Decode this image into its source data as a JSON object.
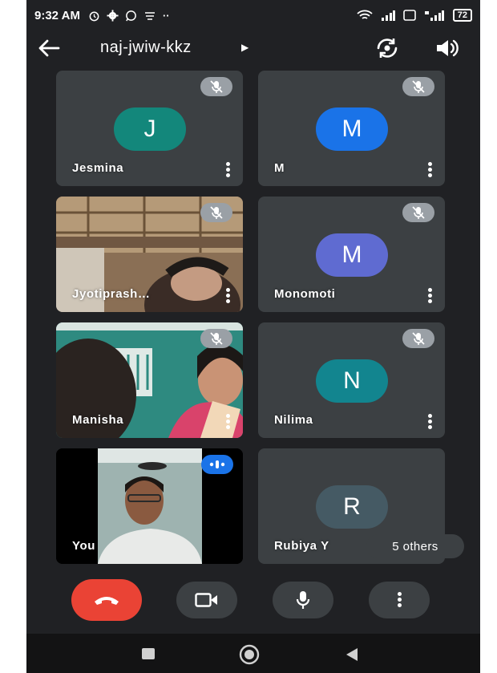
{
  "status_bar": {
    "time": "9:32 AM",
    "battery": "72",
    "left_icons": [
      "alarm-icon",
      "gear-icon",
      "whatsapp-icon",
      "notification-icon"
    ],
    "right_icons": [
      "wifi-icon",
      "signal-icon",
      "volte-icon",
      "signal-4g-icon"
    ]
  },
  "meeting": {
    "code": "naj-jwiw-kkz"
  },
  "participants": [
    {
      "name": "Jesmina",
      "initial": "J",
      "color": "#13877b",
      "video": false,
      "muted": true
    },
    {
      "name": "M",
      "initial": "M",
      "color": "#1a73e8",
      "video": false,
      "muted": true
    },
    {
      "name": "Jyotiprash…",
      "initial": "",
      "video": true,
      "muted": true
    },
    {
      "name": "Monomoti",
      "initial": "M",
      "color": "#5f6bd1",
      "video": false,
      "muted": true
    },
    {
      "name": "Manisha",
      "initial": "",
      "video": true,
      "muted": true
    },
    {
      "name": "Nilima",
      "initial": "N",
      "color": "#12858f",
      "video": false,
      "muted": true
    },
    {
      "name": "You",
      "initial": "",
      "video": true,
      "muted": false,
      "speaking": true
    },
    {
      "name": "Rubiya Y",
      "initial": "R",
      "color": "#455a64",
      "video": false,
      "muted": false
    }
  ],
  "others": {
    "label": "5 others"
  },
  "controls": {
    "end_call_color": "#ea4335",
    "buttons": [
      "end-call-icon",
      "camera-icon",
      "microphone-icon",
      "more-options-icon"
    ]
  },
  "colors": {
    "background": "#202124",
    "tile": "#3c4043",
    "speaking_badge": "#1a73e8"
  }
}
